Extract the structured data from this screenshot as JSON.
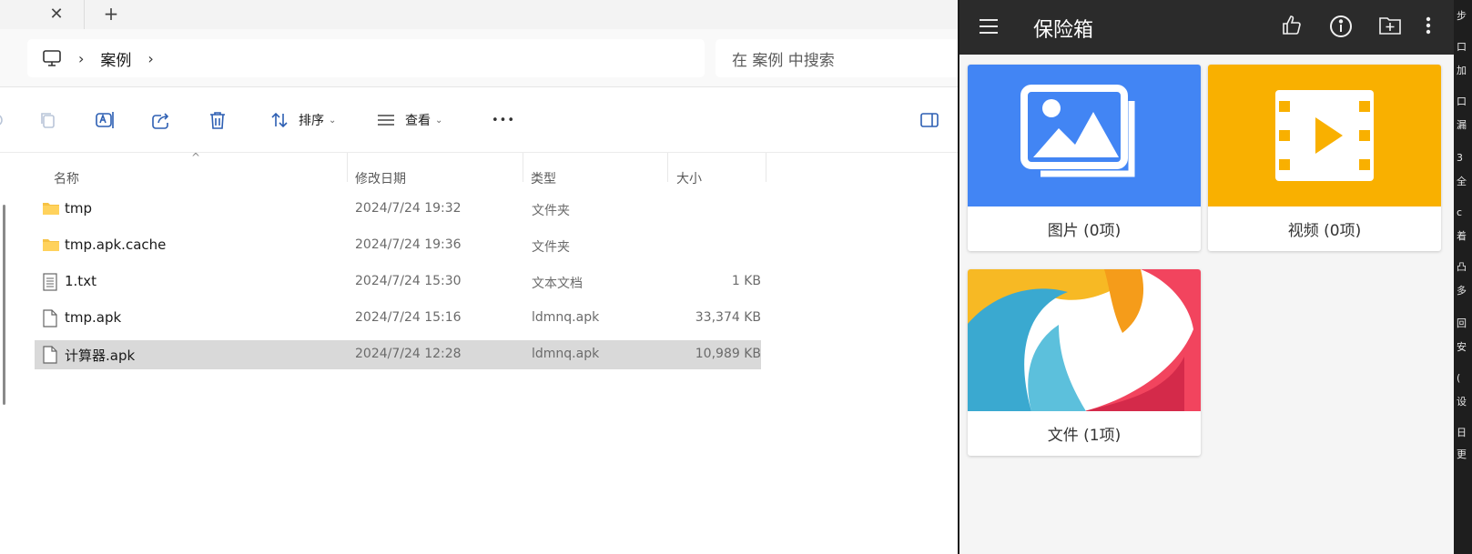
{
  "explorer": {
    "tab_close_glyph": "✕",
    "tab_new_glyph": "+",
    "breadcrumb": {
      "separator": "›",
      "folder": "案例"
    },
    "search_placeholder": "在 案例 中搜索",
    "toolbar": {
      "sort_label": "排序",
      "view_label": "查看",
      "more_glyph": "•••",
      "chevron": "⌄"
    },
    "columns": {
      "name": "名称",
      "date": "修改日期",
      "type": "类型",
      "size": "大小"
    },
    "sort_caret": "^",
    "files": [
      {
        "name": "tmp",
        "date": "2024/7/24 19:32",
        "type": "文件夹",
        "size": "",
        "icon": "folder-icon"
      },
      {
        "name": "tmp.apk.cache",
        "date": "2024/7/24 19:36",
        "type": "文件夹",
        "size": "",
        "icon": "folder-icon"
      },
      {
        "name": "1.txt",
        "date": "2024/7/24 15:30",
        "type": "文本文档",
        "size": "1 KB",
        "icon": "text-file-icon"
      },
      {
        "name": "tmp.apk",
        "date": "2024/7/24 15:16",
        "type": "ldmnq.apk",
        "size": "33,374 KB",
        "icon": "file-icon"
      },
      {
        "name": "计算器.apk",
        "date": "2024/7/24 12:28",
        "type": "ldmnq.apk",
        "size": "10,989 KB",
        "icon": "file-icon",
        "selected": true
      }
    ]
  },
  "vault": {
    "title": "保险箱",
    "cards": [
      {
        "label": "图片 (0项)",
        "color": "#4285f4",
        "icon": "gallery-icon"
      },
      {
        "label": "视频 (0项)",
        "color": "#f9b000",
        "icon": "video-icon"
      },
      {
        "label": "文件 (1项)",
        "icon": "aperture-icon"
      }
    ]
  },
  "right_strip": {
    "glyphs": [
      "步",
      "口",
      "加",
      "口",
      "漏",
      "3",
      "全",
      "c",
      "着",
      "凸",
      "多",
      "回",
      "安",
      "(",
      "设",
      "日",
      "更"
    ]
  }
}
